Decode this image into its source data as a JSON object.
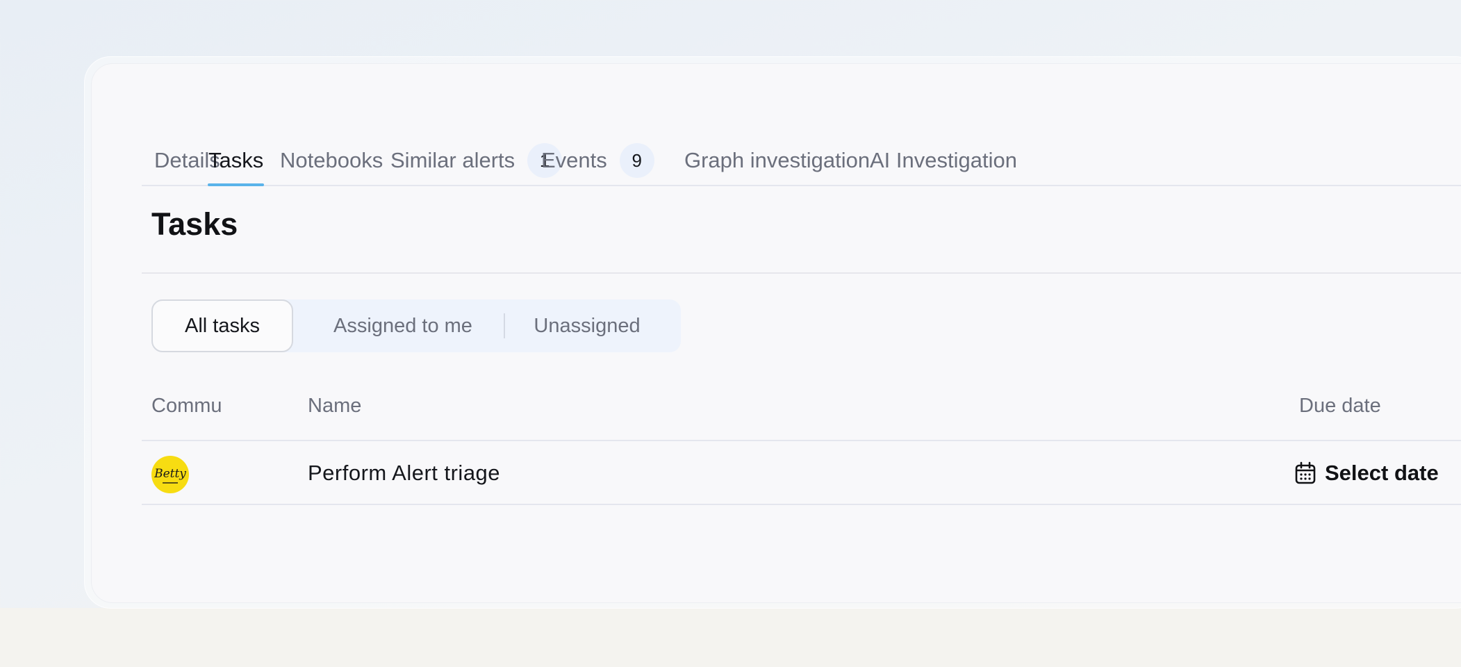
{
  "tabs": [
    {
      "label": "Details",
      "count": null
    },
    {
      "label": "Tasks",
      "count": null
    },
    {
      "label": "Notebooks",
      "count": null
    },
    {
      "label": "Similar alerts",
      "count": "1"
    },
    {
      "label": "Events",
      "count": "9"
    },
    {
      "label": "Graph investigation",
      "count": null
    },
    {
      "label": "AI Investigation",
      "count": null
    }
  ],
  "active_tab": "Tasks",
  "page": {
    "title": "Tasks"
  },
  "filters": {
    "options": [
      "All tasks",
      "Assigned to me",
      "Unassigned"
    ],
    "selected": "All tasks"
  },
  "table": {
    "columns": [
      "Commu",
      "Name",
      "Due date"
    ],
    "rows": [
      {
        "community_logo_text": "Betty",
        "community_logo_color": "#f7dc12",
        "community_logo_icon": "betty-logo-icon",
        "name": "Perform Alert triage",
        "due_date": "Select date",
        "due_date_icon": "calendar-icon"
      }
    ]
  },
  "colors": {
    "accent": "#5ab3ea",
    "badge_bg": "#eaf0fb",
    "segmented_bg": "#eef3fc"
  }
}
